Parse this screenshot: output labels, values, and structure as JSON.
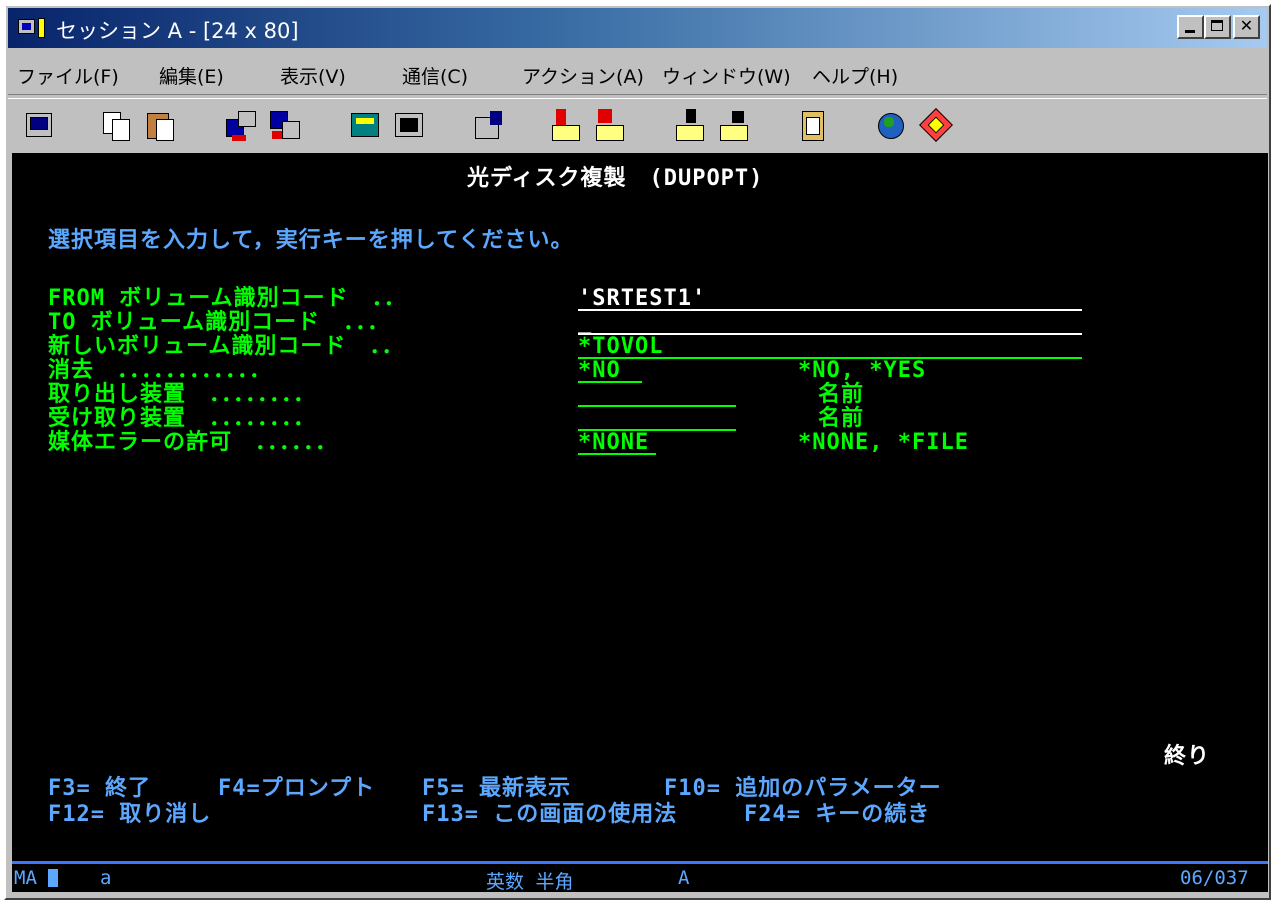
{
  "window": {
    "title": "セッション A - [24 x 80]"
  },
  "menu": [
    "ファイル(F)",
    "編集(E)",
    "表示(V)",
    "通信(C)",
    "アクション(A)",
    "ウィンドウ(W)",
    "ヘルプ(H)"
  ],
  "toolbar_icons": [
    "print-screen-icon",
    "copy-icon",
    "paste-icon",
    "send-icon",
    "receive-icon",
    "display-icon",
    "keypad-icon",
    "edit-icon",
    "macro-record-icon",
    "macro-stop-icon",
    "macro-play-icon",
    "macro-edit-icon",
    "clipboard-icon",
    "globe-icon",
    "help-icon"
  ],
  "screen": {
    "title": "光ディスク複製　(DUPOPT)",
    "instruction": "選択項目を入力して，実行キーを押してください。",
    "fields": [
      {
        "label": "FROM ボリューム識別コード　．．",
        "value": "'SRTEST1'",
        "hint": ""
      },
      {
        "label": "TO ボリューム識別コード　．．．",
        "value": "_",
        "hint": ""
      },
      {
        "label": "新しいボリューム識別コード　．．",
        "value": "*TOVOL",
        "hint": ""
      },
      {
        "label": "消去　．．．．．．．．．．．．",
        "value": "*NO",
        "hint": "*NO, *YES"
      },
      {
        "label": "取り出し装置　．．．．．．．．",
        "value": "",
        "hint": "名前"
      },
      {
        "label": "受け取り装置　．．．．．．．．",
        "value": "",
        "hint": "名前"
      },
      {
        "label": "媒体エラーの許可　．．．．．．",
        "value": "*NONE",
        "hint": "*NONE, *FILE"
      }
    ],
    "end_label": "終り",
    "fkeys_row1": [
      "F3= 終了",
      "F4=プロンプト",
      "F5= 最新表示",
      "F10= 追加のパラメーター"
    ],
    "fkeys_row2": [
      "F12= 取り消し",
      "F13= この画面の使用法",
      "F24= キーの続き"
    ]
  },
  "status": {
    "left": "MA",
    "session": "a",
    "mode": "英数 半角",
    "indicator": "A",
    "cursor_pos": "06/037"
  },
  "colors": {
    "screen_bg": "#000000",
    "title_text": "#ffffff",
    "instruction_text": "#5ca8ff",
    "field_text": "#00ff00",
    "titlebar": "#08246b"
  }
}
